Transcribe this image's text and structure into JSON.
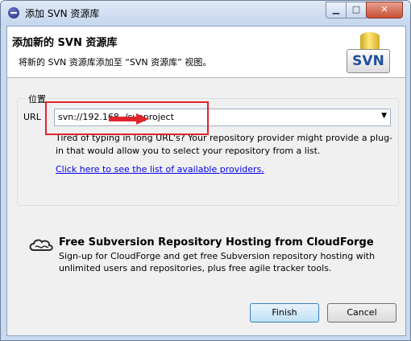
{
  "window": {
    "title": "添加 SVN 资源库",
    "controls": {
      "minimize": "▁",
      "maximize": "□",
      "close": "✕"
    }
  },
  "header": {
    "title": "添加新的 SVN 资源库",
    "description": "将新的 SVN 资源库添加至 “SVN 资源库” 视图。",
    "logo_text": "SVN"
  },
  "location": {
    "group_label": "位置",
    "url_label": "URL",
    "url_value": "svn://192.168.   /svnproject",
    "hint": "Tired of typing in long URL's? Your repository provider might provide a plug-in that would allow you to select your repository from a list.",
    "providers_link": "Click here to see the list of available providers."
  },
  "cloudforge": {
    "title": "Free Subversion Repository Hosting from CloudForge",
    "description": "Sign-up for CloudForge and get free Subversion repository hosting with unlimited users and repositories, plus free agile tracker tools."
  },
  "buttons": {
    "finish": "Finish",
    "cancel": "Cancel"
  },
  "colors": {
    "annotation_red": "#e0242c",
    "link_blue": "#0000ee"
  }
}
